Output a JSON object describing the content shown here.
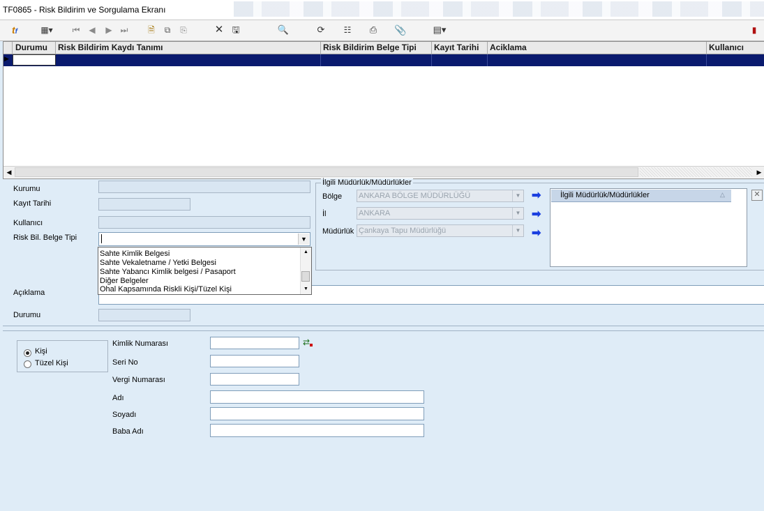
{
  "window": {
    "title": "TF0865 - Risk Bildirim ve Sorgulama Ekranı"
  },
  "toolbar": {
    "icons": [
      "logo-icon",
      "grid-menu-icon",
      "first-record-icon",
      "prev-record-icon",
      "next-record-icon",
      "last-record-icon",
      "new-doc-icon",
      "copy-doc-icon",
      "paste-doc-icon",
      "delete-icon",
      "save-icon",
      "preview-icon",
      "refresh-icon",
      "tree-icon",
      "print-icon",
      "attach-icon",
      "layout-menu-icon",
      "exit-icon"
    ]
  },
  "grid": {
    "columns": [
      "Durumu",
      "Risk Bildirim Kaydı Tanımı",
      "Risk Bildirim Belge Tipi",
      "Kayıt Tarihi",
      "Aciklama",
      "Kullanıcı"
    ]
  },
  "form": {
    "kurumu_label": "Kurumu",
    "kayit_tarihi_label": "Kayıt Tarihi",
    "kullanici_label": "Kullanıcı",
    "risk_belge_label": "Risk Bil. Belge Tipi",
    "aciklama_label": "Açıklama",
    "durumu_label": "Durumu",
    "risk_belge_options": [
      "Sahte Kimlik Belgesi",
      "Sahte Vekaletname / Yetki Belgesi",
      "Sahte Yabancı Kimlik belgesi / Pasaport",
      "Diğer Belgeler",
      "Ohal Kapsamında Riskli Kişi/Tüzel Kişi"
    ]
  },
  "mudurluk": {
    "group_title": "İlgili Müdürlük/Müdürlükler",
    "bolge_label": "Bölge",
    "bolge_value": "ANKARA BÖLGE MÜDÜRLÜĞÜ",
    "il_label": "İl",
    "il_value": "ANKARA",
    "mudurluk_label": "Müdürlük",
    "mudurluk_value": "Çankaya Tapu Müdürlüğü",
    "list_header": "İlgili Müdürlük/Müdürlükler"
  },
  "person": {
    "kisi_label": "Kişi",
    "tuzel_label": "Tüzel Kişi",
    "selected": "Kişi",
    "kimlik_label": "Kimlik Numarası",
    "seri_label": "Seri No",
    "vergi_label": "Vergi Numarası",
    "adi_label": "Adı",
    "soyadi_label": "Soyadı",
    "baba_label": "Baba Adı"
  },
  "colors": {
    "grid_selected_row": "#0a1a6e",
    "background": "#dfecf7",
    "arrow_blue": "#1a3fe0"
  }
}
